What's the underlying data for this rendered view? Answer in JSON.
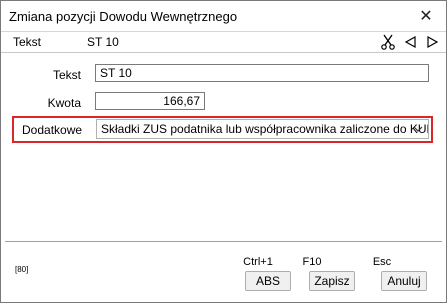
{
  "window": {
    "title": "Zmiana pozycji Dowodu Wewnętrznego",
    "close_glyph": "✕"
  },
  "toolbar": {
    "label": "Tekst",
    "value": "ST 10"
  },
  "form": {
    "tekst_label": "Tekst",
    "tekst_value": "ST 10",
    "kwota_label": "Kwota",
    "kwota_value": "166,67",
    "dodatkowe_label": "Dodatkowe",
    "dodatkowe_value": "Składki ZUS podatnika lub współpracownika zaliczone do KUP",
    "highlight_color": "#d9262b"
  },
  "footer": {
    "code": "[80]",
    "abs": {
      "shortcut": "Ctrl+1",
      "label": "ABS"
    },
    "zapisz": {
      "shortcut": "F10",
      "label": "Zapisz"
    },
    "anuluj": {
      "shortcut": "Esc",
      "label": "Anuluj"
    }
  },
  "icons": [
    "scissors-icon",
    "arrow-left-icon",
    "arrow-right-icon",
    "chevron-down-icon",
    "close-icon"
  ]
}
